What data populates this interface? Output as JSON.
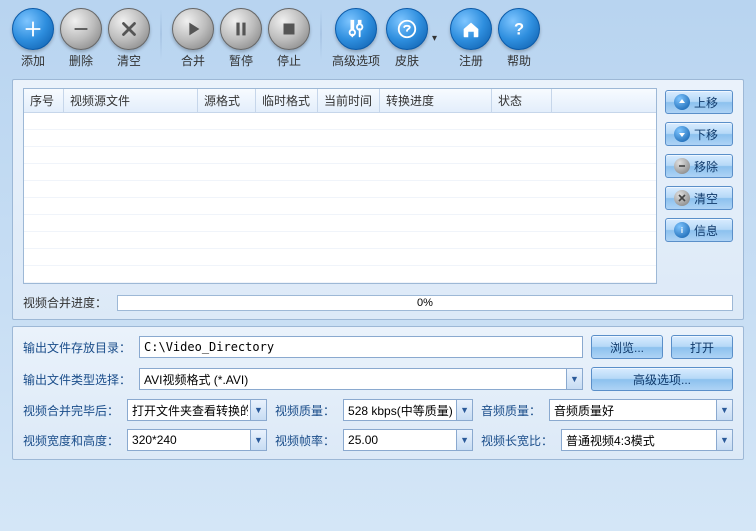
{
  "toolbar": {
    "add": "添加",
    "delete": "删除",
    "clear": "清空",
    "merge": "合并",
    "pause": "暂停",
    "stop": "停止",
    "advanced": "高级选项",
    "skin": "皮肤",
    "register": "注册",
    "help": "帮助"
  },
  "table": {
    "headers": {
      "seq": "序号",
      "source": "视频源文件",
      "src_fmt": "源格式",
      "tmp_fmt": "临时格式",
      "cur_time": "当前时间",
      "progress": "转换进度",
      "status": "状态"
    }
  },
  "side": {
    "up": "上移",
    "down": "下移",
    "remove": "移除",
    "clear": "清空",
    "info": "信息"
  },
  "merge_progress": {
    "label": "视频合并进度：",
    "text": "0%"
  },
  "output": {
    "dir_label": "输出文件存放目录：",
    "dir_value": "C:\\Video_Directory",
    "browse": "浏览...",
    "open": "打开",
    "type_label": "输出文件类型选择：",
    "type_value": "AVI视频格式 (*.AVI)",
    "adv_options": "高级选项...",
    "after_merge_label": "视频合并完毕后：",
    "after_merge_value": "打开文件夹查看转换的",
    "vquality_label": "视频质量：",
    "vquality_value": "528 kbps(中等质量)",
    "aquality_label": "音频质量：",
    "aquality_value": "音频质量好",
    "size_label": "视频宽度和高度：",
    "size_value": "320*240",
    "fps_label": "视频帧率：",
    "fps_value": "25.00",
    "aspect_label": "视频长宽比：",
    "aspect_value": "普通视频4:3模式"
  }
}
